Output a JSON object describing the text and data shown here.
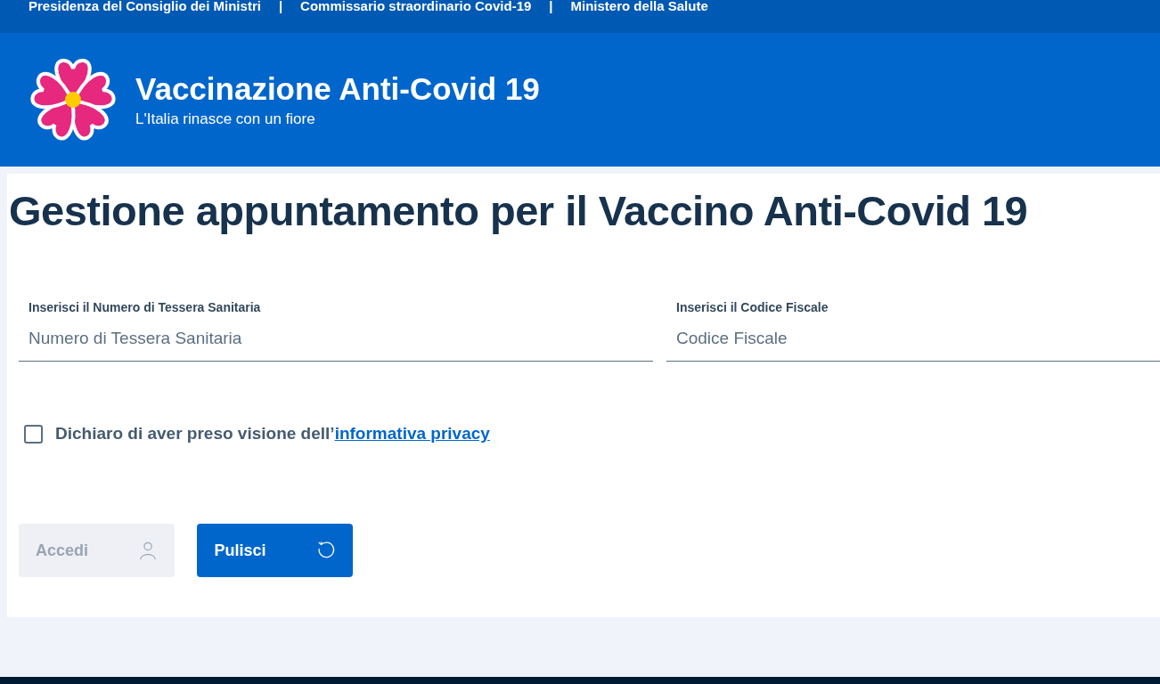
{
  "top_bar": {
    "links": [
      "Presidenza del Consiglio dei Ministri",
      "Commissario straordinario Covid-19",
      "Ministero della Salute"
    ],
    "separators": [
      "|",
      "|"
    ]
  },
  "header": {
    "title": "Vaccinazione Anti-Covid 19",
    "subtitle": "L'Italia rinasce con un fiore"
  },
  "page_title": "Gestione appuntamento per il Vaccino Anti-Covid 19",
  "fields": [
    {
      "label": "Inserisci il Numero di Tessera Sanitaria",
      "placeholder": "Numero di Tessera Sanitaria"
    },
    {
      "label": "Inserisci il Codice Fiscale",
      "placeholder": "Codice Fiscale"
    }
  ],
  "consent": {
    "checked": false,
    "text": "Dichiaro di aver preso visione dell’",
    "link": "informativa privacy"
  },
  "buttons": [
    {
      "label": "Accedi",
      "kind": "login",
      "disabled": true
    },
    {
      "label": "Pulisci",
      "kind": "reset",
      "disabled": false
    }
  ]
}
